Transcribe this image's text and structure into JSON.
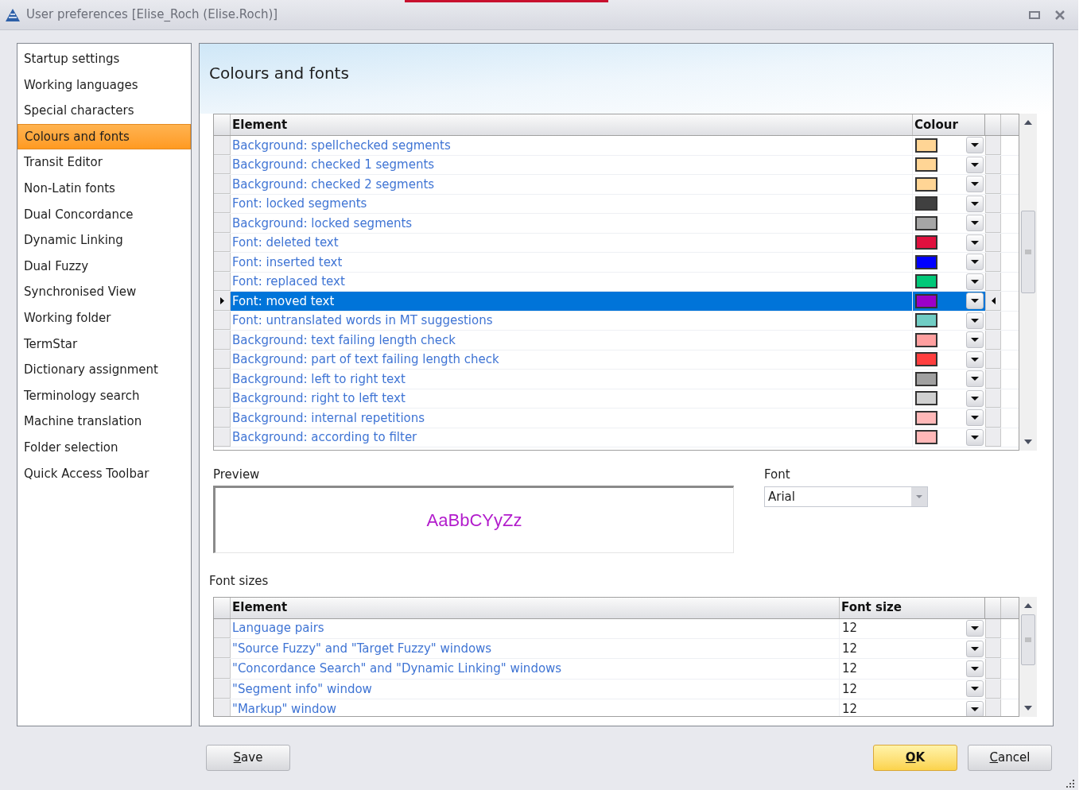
{
  "window": {
    "title": "User preferences [Elise_Roch (Elise.Roch)]"
  },
  "sidebar": {
    "items": [
      {
        "label": "Startup settings",
        "selected": false
      },
      {
        "label": "Working languages",
        "selected": false
      },
      {
        "label": "Special characters",
        "selected": false
      },
      {
        "label": "Colours and fonts",
        "selected": true
      },
      {
        "label": "Transit Editor",
        "selected": false
      },
      {
        "label": "Non-Latin fonts",
        "selected": false
      },
      {
        "label": "Dual Concordance",
        "selected": false
      },
      {
        "label": "Dynamic Linking",
        "selected": false
      },
      {
        "label": "Dual Fuzzy",
        "selected": false
      },
      {
        "label": "Synchronised View",
        "selected": false
      },
      {
        "label": "Working folder",
        "selected": false
      },
      {
        "label": "TermStar",
        "selected": false
      },
      {
        "label": "Dictionary assignment",
        "selected": false
      },
      {
        "label": "Terminology search",
        "selected": false
      },
      {
        "label": "Machine translation",
        "selected": false
      },
      {
        "label": "Folder selection",
        "selected": false
      },
      {
        "label": "Quick Access Toolbar",
        "selected": false
      }
    ]
  },
  "panel": {
    "title": "Colours and fonts"
  },
  "colour_table": {
    "columns": [
      "Element",
      "Colour"
    ],
    "rows": [
      {
        "element": "Background: spellchecked segments",
        "color": "#ffd595",
        "selected": false
      },
      {
        "element": "Background: checked 1 segments",
        "color": "#ffd595",
        "selected": false
      },
      {
        "element": "Background: checked 2 segments",
        "color": "#ffd595",
        "selected": false
      },
      {
        "element": "Font: locked segments",
        "color": "#404040",
        "selected": false
      },
      {
        "element": "Background: locked segments",
        "color": "#a6a6a6",
        "selected": false
      },
      {
        "element": "Font: deleted text",
        "color": "#e0103e",
        "selected": false
      },
      {
        "element": "Font: inserted text",
        "color": "#0000ff",
        "selected": false
      },
      {
        "element": "Font: replaced text",
        "color": "#00c878",
        "selected": false
      },
      {
        "element": "Font: moved text",
        "color": "#9b00c8",
        "selected": true
      },
      {
        "element": "Font: untranslated words in MT suggestions",
        "color": "#70cdc4",
        "selected": false
      },
      {
        "element": "Background: text failing length check",
        "color": "#ff9f9f",
        "selected": false
      },
      {
        "element": "Background: part of text failing length check",
        "color": "#ff3e3e",
        "selected": false
      },
      {
        "element": "Background: left to right text",
        "color": "#a0a0a0",
        "selected": false
      },
      {
        "element": "Background: right to left text",
        "color": "#d0d0d0",
        "selected": false
      },
      {
        "element": "Background: internal repetitions",
        "color": "#ffb8b8",
        "selected": false
      },
      {
        "element": "Background: according to filter",
        "color": "#ffb8b8",
        "selected": false
      }
    ]
  },
  "preview": {
    "label": "Preview",
    "sample": "AaBbCYyZz",
    "color": "#b21ccc"
  },
  "font": {
    "label": "Font",
    "value": "Arial"
  },
  "font_sizes": {
    "label": "Font sizes",
    "columns": [
      "Element",
      "Font size"
    ],
    "rows": [
      {
        "element": "Language pairs",
        "size": "12"
      },
      {
        "element": "\"Source Fuzzy\" and \"Target Fuzzy\" windows",
        "size": "12"
      },
      {
        "element": "\"Concordance Search\" and \"Dynamic Linking\" windows",
        "size": "12"
      },
      {
        "element": "\"Segment info\" window",
        "size": "12"
      },
      {
        "element": "\"Markup\" window",
        "size": "12"
      }
    ]
  },
  "buttons": [
    {
      "label": "Save",
      "kind": "secondary"
    },
    {
      "label": "OK",
      "kind": "primary"
    },
    {
      "label": "Cancel",
      "kind": "secondary"
    }
  ]
}
